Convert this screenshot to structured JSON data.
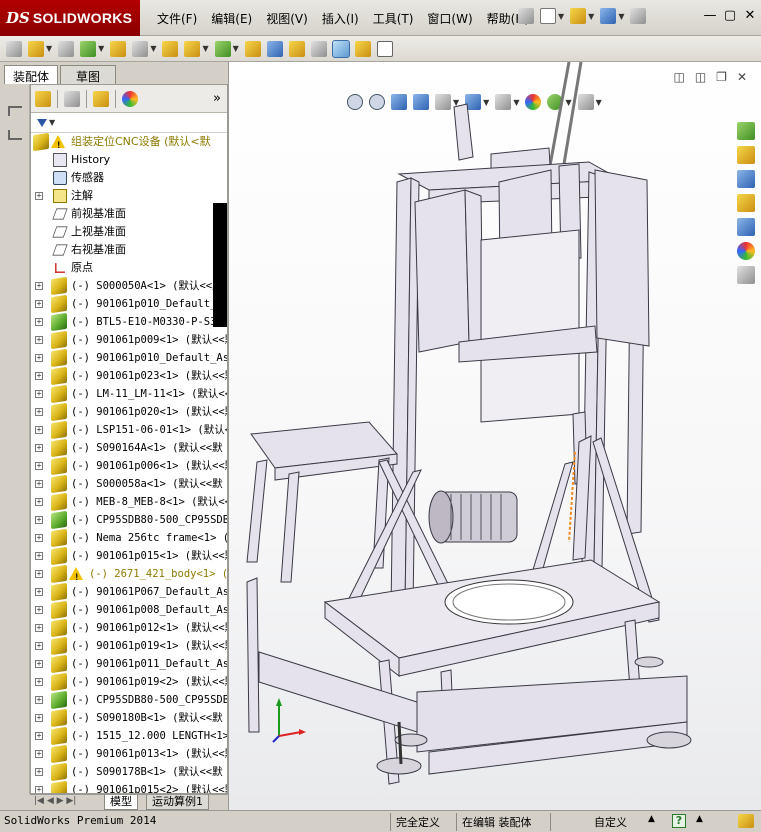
{
  "app": {
    "brand_ds": "DS",
    "brand_name": "SOLIDWORKS"
  },
  "menu": [
    "文件(F)",
    "编辑(E)",
    "视图(V)",
    "插入(I)",
    "工具(T)",
    "窗口(W)",
    "帮助(H)"
  ],
  "panel_tabs": [
    "装配体",
    "草图"
  ],
  "tree": {
    "root": "组装定位CNC设备  (默认<默",
    "features": [
      {
        "label": "History",
        "icon": "history-icon"
      },
      {
        "label": "传感器",
        "icon": "sensor-icon"
      },
      {
        "label": "注解",
        "icon": "annotation-icon",
        "expand": true
      },
      {
        "label": "前视基准面",
        "icon": "plane-icon"
      },
      {
        "label": "上视基准面",
        "icon": "plane-icon"
      },
      {
        "label": "右视基准面",
        "icon": "plane-icon"
      },
      {
        "label": "原点",
        "icon": "origin-icon"
      }
    ],
    "parts": [
      {
        "label": "(-) S000050A<1> (默认<<默",
        "color": "yellow"
      },
      {
        "label": "(-) 901061p010_Default_As",
        "color": "yellow"
      },
      {
        "label": "(-) BTL5-E10-M0330-P-S32<1",
        "color": "green"
      },
      {
        "label": "(-) 901061p009<1> (默认<<默",
        "color": "yellow"
      },
      {
        "label": "(-) 901061p010_Default_As",
        "color": "yellow"
      },
      {
        "label": "(-) 901061p023<1> (默认<<默",
        "color": "yellow"
      },
      {
        "label": "(-) LM-11_LM-11<1> (默认<<",
        "color": "yellow"
      },
      {
        "label": "(-) 901061p020<1> (默认<<默",
        "color": "yellow"
      },
      {
        "label": "(-) LSP151-06-01<1> (默认<",
        "color": "yellow"
      },
      {
        "label": "(-) S090164A<1> (默认<<默",
        "color": "yellow"
      },
      {
        "label": "(-) 901061p006<1> (默认<<默",
        "color": "yellow"
      },
      {
        "label": "(-) S000058a<1> (默认<<默",
        "color": "yellow"
      },
      {
        "label": "(-) MEB-8_MEB-8<1> (默认<<",
        "color": "yellow"
      },
      {
        "label": "(-) CP95SDB80-500_CP95SDB8",
        "color": "green"
      },
      {
        "label": "(-) Nema 256tc frame<1> (默",
        "color": "yellow"
      },
      {
        "label": "(-) 901061p015<1> (默认<<默",
        "color": "yellow"
      },
      {
        "label": "(-) 2671_421_body<1> (默认<",
        "color": "yellow",
        "warning": true
      },
      {
        "label": "(-) 901061P067_Default_As",
        "color": "yellow"
      },
      {
        "label": "(-) 901061p008_Default_As",
        "color": "yellow"
      },
      {
        "label": "(-) 901061p012<1> (默认<<默",
        "color": "yellow"
      },
      {
        "label": "(-) 901061p019<1> (默认<<默",
        "color": "yellow"
      },
      {
        "label": "(-) 901061p011_Default_As",
        "color": "yellow"
      },
      {
        "label": "(-) 901061p019<2> (默认<<默",
        "color": "yellow"
      },
      {
        "label": "(-) CP95SDB80-500_CP95SDB8",
        "color": "green"
      },
      {
        "label": "(-) S090180B<1> (默认<<默",
        "color": "yellow"
      },
      {
        "label": "(-) 1515_12.000 LENGTH<1>",
        "color": "yellow"
      },
      {
        "label": "(-) 901061p013<1> (默认<<默",
        "color": "yellow"
      },
      {
        "label": "(-) S090178B<1> (默认<<默",
        "color": "yellow"
      },
      {
        "label": "(-) 901061p015<2> (默认<<默",
        "color": "yellow"
      }
    ]
  },
  "bottom_tabs": [
    "模型",
    "运动算例1"
  ],
  "status": {
    "product": "SolidWorks Premium 2014",
    "constraint": "完全定义",
    "mode": "在编辑 装配体",
    "units": "自定义"
  }
}
